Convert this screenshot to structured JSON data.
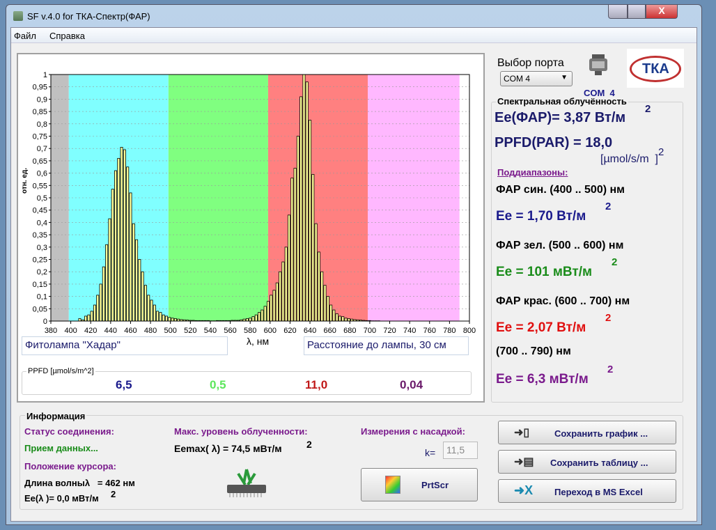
{
  "window": {
    "title": "SF v.4.0 for ТКА-Спектр(ФАР)",
    "close_label": "X"
  },
  "menu": {
    "file": "Файл",
    "help": "Справка"
  },
  "chart_data": {
    "type": "bar",
    "xlabel": "λ, нм",
    "ylabel": "отн. ед.",
    "xlim": [
      380,
      800
    ],
    "ylim": [
      0,
      1
    ],
    "xticks": [
      380,
      400,
      420,
      440,
      460,
      480,
      500,
      520,
      540,
      560,
      580,
      600,
      620,
      640,
      660,
      680,
      700,
      720,
      740,
      760,
      780,
      800
    ],
    "yticks": [
      "0",
      "0,05",
      "0,1",
      "0,15",
      "0,2",
      "0,25",
      "0,3",
      "0,35",
      "0,4",
      "0,45",
      "0,5",
      "0,55",
      "0,6",
      "0,65",
      "0,7",
      "0,75",
      "0,8",
      "0,85",
      "0,9",
      "0,95",
      "1"
    ],
    "bands": [
      {
        "from": 380,
        "to": 398,
        "color": "#c0c0c0"
      },
      {
        "from": 398,
        "to": 498,
        "color": "#80ffff"
      },
      {
        "from": 498,
        "to": 598,
        "color": "#80ff80"
      },
      {
        "from": 598,
        "to": 698,
        "color": "#ff8080"
      },
      {
        "from": 698,
        "to": 790,
        "color": "#ffb8ff"
      }
    ],
    "bar_color": "#ffff99",
    "x": [
      409,
      412,
      415,
      418,
      421,
      424,
      427,
      430,
      433,
      436,
      439,
      442,
      445,
      448,
      451,
      454,
      457,
      460,
      463,
      466,
      469,
      472,
      475,
      478,
      481,
      484,
      487,
      490,
      493,
      496,
      499,
      502,
      505,
      508,
      511,
      514,
      517,
      520,
      523,
      526,
      529,
      532,
      535,
      538,
      541,
      544,
      547,
      550,
      553,
      556,
      559,
      562,
      565,
      568,
      571,
      574,
      577,
      580,
      583,
      586,
      589,
      592,
      595,
      598,
      601,
      604,
      607,
      610,
      613,
      616,
      619,
      622,
      625,
      628,
      631,
      634,
      637,
      640,
      643,
      646,
      649,
      652,
      655,
      658,
      661,
      664,
      667,
      670,
      673,
      676,
      679,
      682,
      685,
      688,
      691,
      694,
      697,
      700,
      703,
      706,
      709
    ],
    "values": [
      0.01,
      0.005,
      0.02,
      0.025,
      0.04,
      0.065,
      0.105,
      0.15,
      0.22,
      0.31,
      0.415,
      0.535,
      0.61,
      0.66,
      0.705,
      0.695,
      0.625,
      0.52,
      0.395,
      0.33,
      0.25,
      0.2,
      0.145,
      0.105,
      0.085,
      0.065,
      0.04,
      0.035,
      0.025,
      0.02,
      0.015,
      0.012,
      0.01,
      0.008,
      0.006,
      0.005,
      0.004,
      0.003,
      0.003,
      0.002,
      0.002,
      0.002,
      0.002,
      0.002,
      0.001,
      0.001,
      0.002,
      0.002,
      0.002,
      0.002,
      0.002,
      0.003,
      0.003,
      0.003,
      0.005,
      0.008,
      0.01,
      0.012,
      0.018,
      0.025,
      0.035,
      0.045,
      0.06,
      0.08,
      0.105,
      0.125,
      0.155,
      0.2,
      0.24,
      0.3,
      0.43,
      0.58,
      0.62,
      0.75,
      0.91,
      1.0,
      0.97,
      0.815,
      0.595,
      0.395,
      0.28,
      0.2,
      0.145,
      0.1,
      0.065,
      0.045,
      0.03,
      0.02,
      0.018,
      0.012,
      0.01,
      0.008,
      0.006,
      0.005,
      0.004,
      0.003,
      0.002,
      0.002,
      0.001,
      0.001,
      0.001
    ]
  },
  "lamp_field": "Фитолампа \"Хадар\"",
  "distance_field": "Расстояние до лампы, 30 см",
  "ppfd": {
    "label": "PPFD [µmol/s/m^2]",
    "blue": "6,5",
    "green": "0,5",
    "red": "11,0",
    "far": "0,04"
  },
  "port": {
    "label": "Выбор порта",
    "selected": "COM 4",
    "status": "COM  4"
  },
  "logo_text": "ТКА",
  "spectral": {
    "title": "Спектральная облучённость",
    "ee_par": "Ee(ФАР)= 3,87 Вт/м",
    "sup": "2",
    "ppfd": "PPFD(PAR) = 18,0",
    "ppfd_unit": "[µmol/s/m  ]",
    "subranges": "Поддиапазоны:",
    "blue_label": "ФАР син. (400 .. 500) нм",
    "blue_value": "Ee = 1,70 Вт/м",
    "green_label": "ФАР зел. (500 .. 600) нм",
    "green_value": "Ee = 101 мВт/м",
    "red_label": "ФАР крас. (600 .. 700) нм",
    "red_value": "Ee = 2,07 Вт/м",
    "far_label": "(700 .. 790) нм",
    "far_value": "Ee = 6,3 мВт/м"
  },
  "info": {
    "title": "Информация",
    "status_label": "Статус соединения:",
    "status_value": "Прием данных...",
    "cursor_label": "Положение курсора:",
    "wavelength": "Длина волныλ   = 462 нм",
    "ee_cursor": "Ee(λ )= 0,0 мВт/м",
    "sup": "2",
    "max_label": "Макс. уровень облученности:",
    "max_value": "Eemax( λ) = 74,5 мВт/м",
    "nozzle_label": "Измерения с насадкой:",
    "k_label": "k=",
    "k_value": "11,5",
    "prtscr": "PrtScr"
  },
  "buttons": {
    "save_chart": "Сохранить график ...",
    "save_table": "Сохранить таблицу ...",
    "excel": "Переход в MS Excel"
  },
  "colors": {
    "blue": "#1a1a8c",
    "green": "#1a8c1a",
    "red": "#e01010",
    "purple": "#7a1a8c"
  }
}
